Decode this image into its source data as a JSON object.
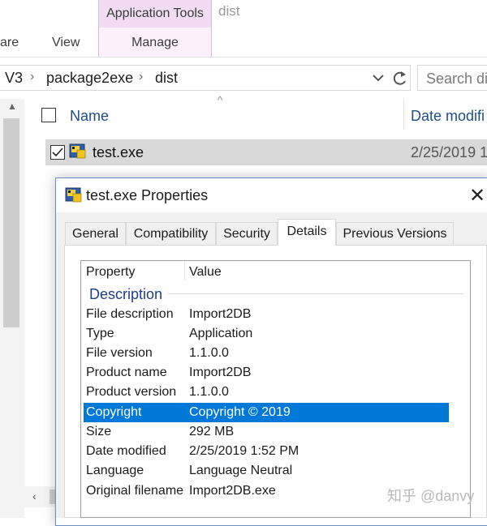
{
  "ribbon": {
    "tabs": [
      "are",
      "View"
    ],
    "context_group": "Application Tools",
    "context_tab": "Manage",
    "window_title": "dist",
    "context_color": "#f1dcf3"
  },
  "address": {
    "crumbs": [
      "V3",
      "package2exe",
      "dist"
    ],
    "search_placeholder": "Search dis"
  },
  "filelist": {
    "columns": {
      "name": "Name",
      "date": "Date modifi"
    },
    "rows": [
      {
        "name": "test.exe",
        "date": "2/25/2019 1"
      }
    ]
  },
  "dialog": {
    "title": "test.exe Properties",
    "tabs": [
      "General",
      "Compatibility",
      "Security",
      "Details",
      "Previous Versions"
    ],
    "active_tab": "Details",
    "columns": {
      "property": "Property",
      "value": "Value"
    },
    "group": "Description",
    "properties": [
      {
        "key": "File description",
        "value": "Import2DB"
      },
      {
        "key": "Type",
        "value": "Application"
      },
      {
        "key": "File version",
        "value": "1.1.0.0"
      },
      {
        "key": "Product name",
        "value": "Import2DB"
      },
      {
        "key": "Product version",
        "value": "1.1.0.0"
      },
      {
        "key": "Copyright",
        "value": "Copyright ©  2019"
      },
      {
        "key": "Size",
        "value": "292 MB"
      },
      {
        "key": "Date modified",
        "value": "2/25/2019 1:52 PM"
      },
      {
        "key": "Language",
        "value": "Language Neutral"
      },
      {
        "key": "Original filename",
        "value": "Import2DB.exe"
      }
    ],
    "selected_property": "Copyright",
    "selection_color": "#0078d7"
  },
  "watermark": "知乎 @danvy"
}
